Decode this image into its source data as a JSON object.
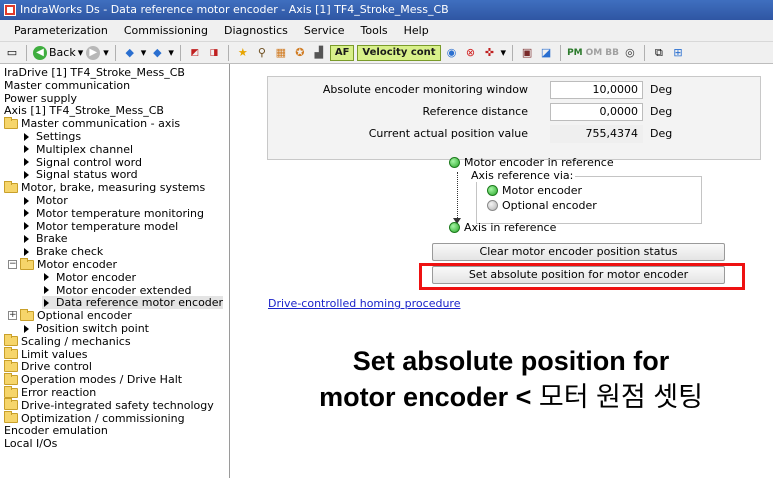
{
  "window": {
    "title": "IndraWorks Ds - Data reference motor encoder - Axis [1] TF4_Stroke_Mess_CB"
  },
  "menu": [
    "Parameterization",
    "Commissioning",
    "Diagnostics",
    "Service",
    "Tools",
    "Help"
  ],
  "toolbar": {
    "back_label": "Back",
    "af_label": "AF",
    "velocity_label": "Velocity cont",
    "pm_label": "PM",
    "om_label": "OM",
    "btn_small": "BB"
  },
  "tree": [
    {
      "label": "IraDrive [1] TF4_Stroke_Mess_CB",
      "level": 0,
      "icon": "none"
    },
    {
      "label": "Master communication",
      "level": 0,
      "icon": "none"
    },
    {
      "label": "Power supply",
      "level": 0,
      "icon": "none"
    },
    {
      "label": "Axis [1] TF4_Stroke_Mess_CB",
      "level": 0,
      "icon": "none"
    },
    {
      "label": "Master communication - axis",
      "level": 0,
      "icon": "folder"
    },
    {
      "label": "Settings",
      "level": 1,
      "icon": "arrow"
    },
    {
      "label": "Multiplex channel",
      "level": 1,
      "icon": "arrow"
    },
    {
      "label": "Signal control word",
      "level": 1,
      "icon": "arrow"
    },
    {
      "label": "Signal status word",
      "level": 1,
      "icon": "arrow"
    },
    {
      "label": "Motor, brake, measuring systems",
      "level": 0,
      "icon": "folder"
    },
    {
      "label": "Motor",
      "level": 1,
      "icon": "arrow"
    },
    {
      "label": "Motor temperature monitoring",
      "level": 1,
      "icon": "arrow"
    },
    {
      "label": "Motor temperature model",
      "level": 1,
      "icon": "arrow"
    },
    {
      "label": "Brake",
      "level": 1,
      "icon": "arrow"
    },
    {
      "label": "Brake check",
      "level": 1,
      "icon": "arrow"
    },
    {
      "label": "Motor encoder",
      "level": 1,
      "icon": "folder-expander"
    },
    {
      "label": "Motor encoder",
      "level": 2,
      "icon": "arrow"
    },
    {
      "label": "Motor encoder extended",
      "level": 2,
      "icon": "arrow"
    },
    {
      "label": "Data reference motor encoder",
      "level": 2,
      "icon": "arrow",
      "selected": true
    },
    {
      "label": "Optional encoder",
      "level": 1,
      "icon": "folder-expander"
    },
    {
      "label": "Position switch point",
      "level": 1,
      "icon": "arrow"
    },
    {
      "label": "Scaling / mechanics",
      "level": 0,
      "icon": "folder"
    },
    {
      "label": "Limit values",
      "level": 0,
      "icon": "folder"
    },
    {
      "label": "Drive control",
      "level": 0,
      "icon": "folder"
    },
    {
      "label": "Operation modes / Drive Halt",
      "level": 0,
      "icon": "folder"
    },
    {
      "label": "Error reaction",
      "level": 0,
      "icon": "folder"
    },
    {
      "label": "Drive-integrated safety technology",
      "level": 0,
      "icon": "folder"
    },
    {
      "label": "Optimization / commissioning",
      "level": 0,
      "icon": "folder"
    },
    {
      "label": "Encoder emulation",
      "level": 0,
      "icon": "none"
    },
    {
      "label": "Local I/Os",
      "level": 0,
      "icon": "none"
    }
  ],
  "fields": [
    {
      "label": "Absolute encoder monitoring window",
      "value": "10,0000",
      "unit": "Deg",
      "readonly": false
    },
    {
      "label": "Reference distance",
      "value": "0,0000",
      "unit": "Deg",
      "readonly": false
    },
    {
      "label": "Current actual position value",
      "value": "755,4374",
      "unit": "Deg",
      "readonly": true
    }
  ],
  "status": {
    "motor_in_reference": "Motor encoder in reference",
    "axis_reference_via": "Axis reference via:",
    "option_motor": "Motor encoder",
    "option_optional": "Optional encoder",
    "axis_in_reference": "Axis in reference"
  },
  "buttons": {
    "clear_status": "Clear motor encoder position status",
    "set_absolute": "Set absolute position for motor encoder"
  },
  "link": "Drive-controlled homing procedure",
  "caption": {
    "line1": "Set absolute position for",
    "line2_en": "motor encoder <",
    "line2_kr": "모터 원점 셋팅"
  },
  "colors": {
    "highlight": "#e11111",
    "link": "#1a22c9",
    "title_bar": "#2f56a3"
  }
}
